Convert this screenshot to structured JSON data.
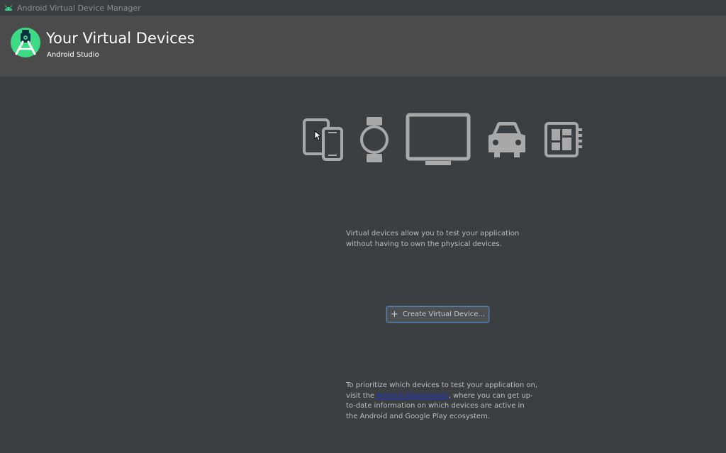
{
  "window": {
    "title": "Android Virtual Device Manager"
  },
  "header": {
    "title": "Your Virtual Devices",
    "subtitle": "Android Studio"
  },
  "device_icons": [
    "phone-tablet-icon",
    "watch-icon",
    "tv-icon",
    "car-icon",
    "things-board-icon"
  ],
  "main": {
    "description": "Virtual devices allow you to test your application without having to own the physical devices.",
    "create_button_label": "Create Virtual Device...",
    "footer_prefix": "To prioritize which devices to test your application on, visit the ",
    "footer_link": "Android Dashboards",
    "footer_suffix": ", where you can get up-to-date information on which devices are active in the Android and Google Play ecosystem."
  },
  "colors": {
    "background": "#3c3f41",
    "header": "#4b4b4b",
    "icon": "#a9a9a9",
    "link": "#2233cc",
    "logo_green": "#3ddc84"
  }
}
